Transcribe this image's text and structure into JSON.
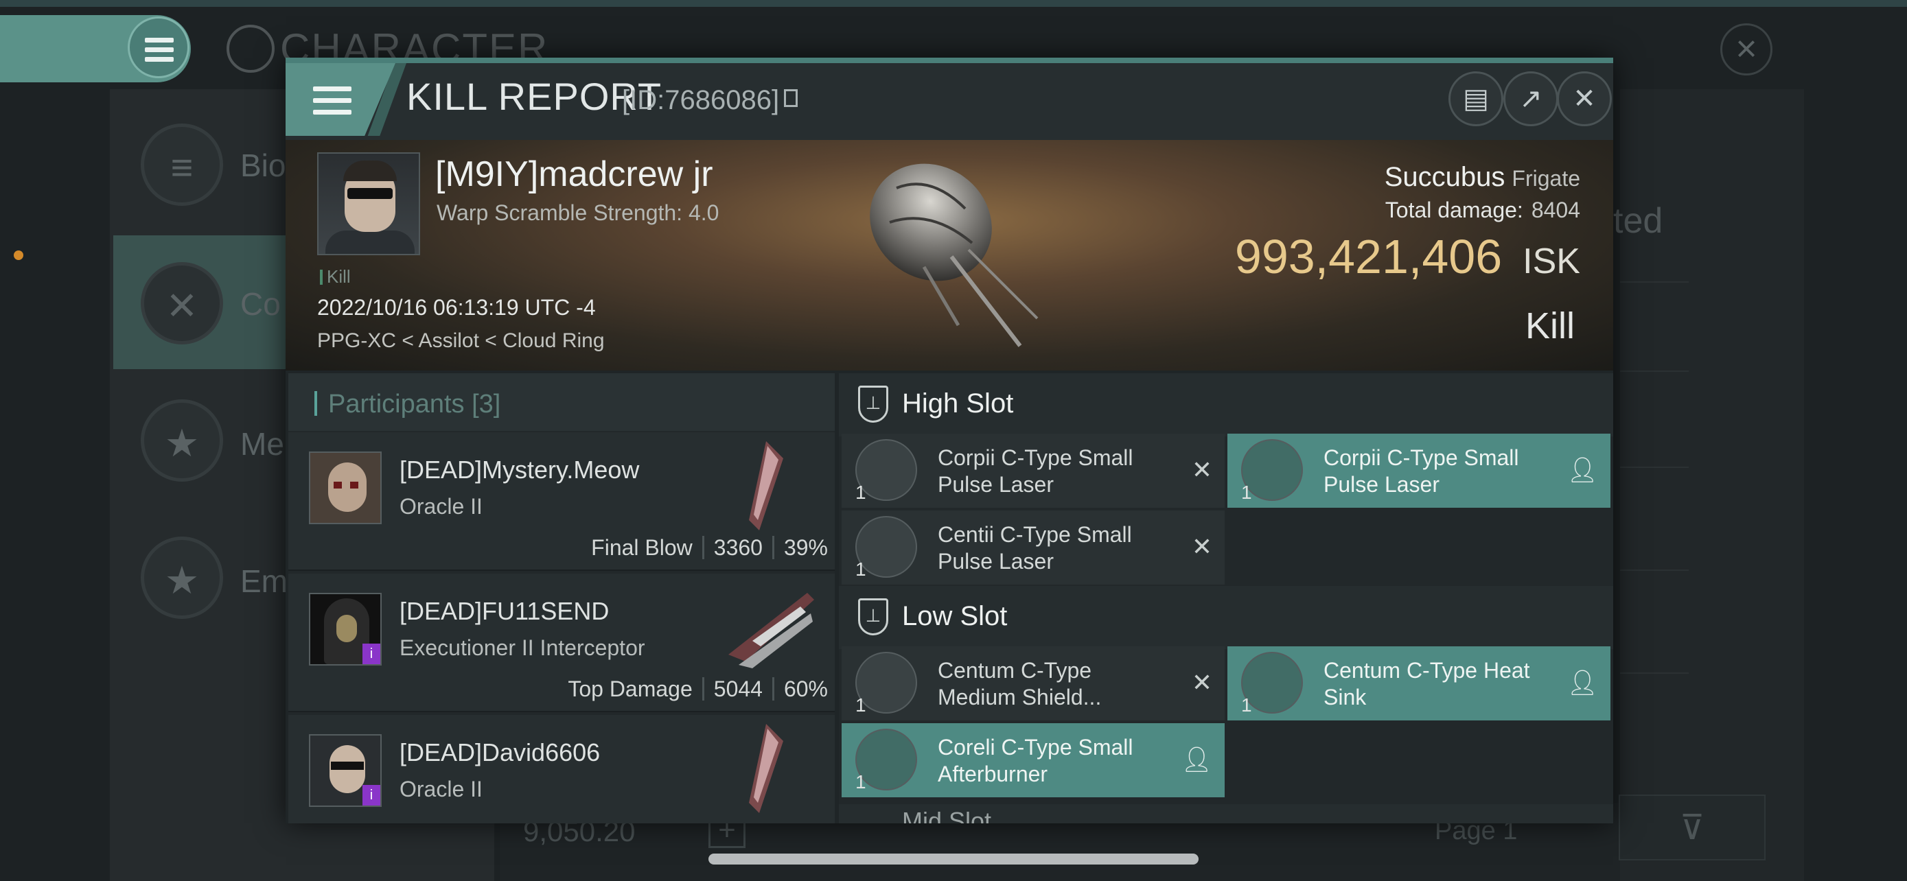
{
  "background": {
    "title": "CHARACTER",
    "menu_items": [
      {
        "label": "Bio",
        "icon": "list-icon"
      },
      {
        "label": "Co",
        "icon": "swords-icon"
      },
      {
        "label": "Me",
        "icon": "star-badge-icon"
      },
      {
        "label": "Em",
        "icon": "star-circle-icon"
      }
    ],
    "right_text": "ted",
    "isk_value": "9,050.20",
    "page_label": "Page 1"
  },
  "modal": {
    "title": "KILL REPORT",
    "id_label": "[ID:7686086]",
    "pilot": {
      "name": "[M9IY]madcrew jr",
      "warp": "Warp Scramble Strength: 4.0",
      "tag": "Kill",
      "time": "2022/10/16 06:13:19 UTC -4",
      "location": "PPG-XC < Assilot < Cloud Ring"
    },
    "ship": {
      "name": "Succubus",
      "class": "Frigate",
      "damage_label": "Total damage:",
      "damage_value": "8404",
      "isk_value": "993,421,406",
      "isk_unit": "ISK",
      "result": "Kill"
    },
    "participants": {
      "header": "Participants [3]",
      "rows": [
        {
          "name": "[DEAD]Mystery.Meow",
          "ship": "Oracle II",
          "stat_label": "Final Blow",
          "damage": "3360",
          "percent": "39%"
        },
        {
          "name": "[DEAD]FU11SEND",
          "ship": "Executioner II Interceptor",
          "stat_label": "Top Damage",
          "damage": "5044",
          "percent": "60%"
        },
        {
          "name": "[DEAD]David6606",
          "ship": "Oracle II"
        }
      ]
    },
    "high_slot": {
      "title": "High Slot",
      "items": [
        {
          "name": "Corpii C-Type Small Pulse Laser",
          "qty": "1",
          "state": "destroyed"
        },
        {
          "name": "Corpii C-Type Small Pulse Laser",
          "qty": "1",
          "state": "dropped"
        },
        {
          "name": "Centii C-Type Small Pulse Laser",
          "qty": "1",
          "state": "destroyed"
        }
      ]
    },
    "low_slot": {
      "title": "Low Slot",
      "items": [
        {
          "name": "Centum C-Type Medium Shield...",
          "qty": "1",
          "state": "destroyed"
        },
        {
          "name": "Centum C-Type Heat Sink",
          "qty": "1",
          "state": "dropped"
        },
        {
          "name": "Coreli C-Type Small Afterburner",
          "qty": "1",
          "state": "dropped"
        }
      ]
    },
    "next_slot_title": "Mid Slot"
  },
  "colors": {
    "accent": "#5a9088",
    "isk": "#e7c98c",
    "dropped": "#4e8a83"
  }
}
